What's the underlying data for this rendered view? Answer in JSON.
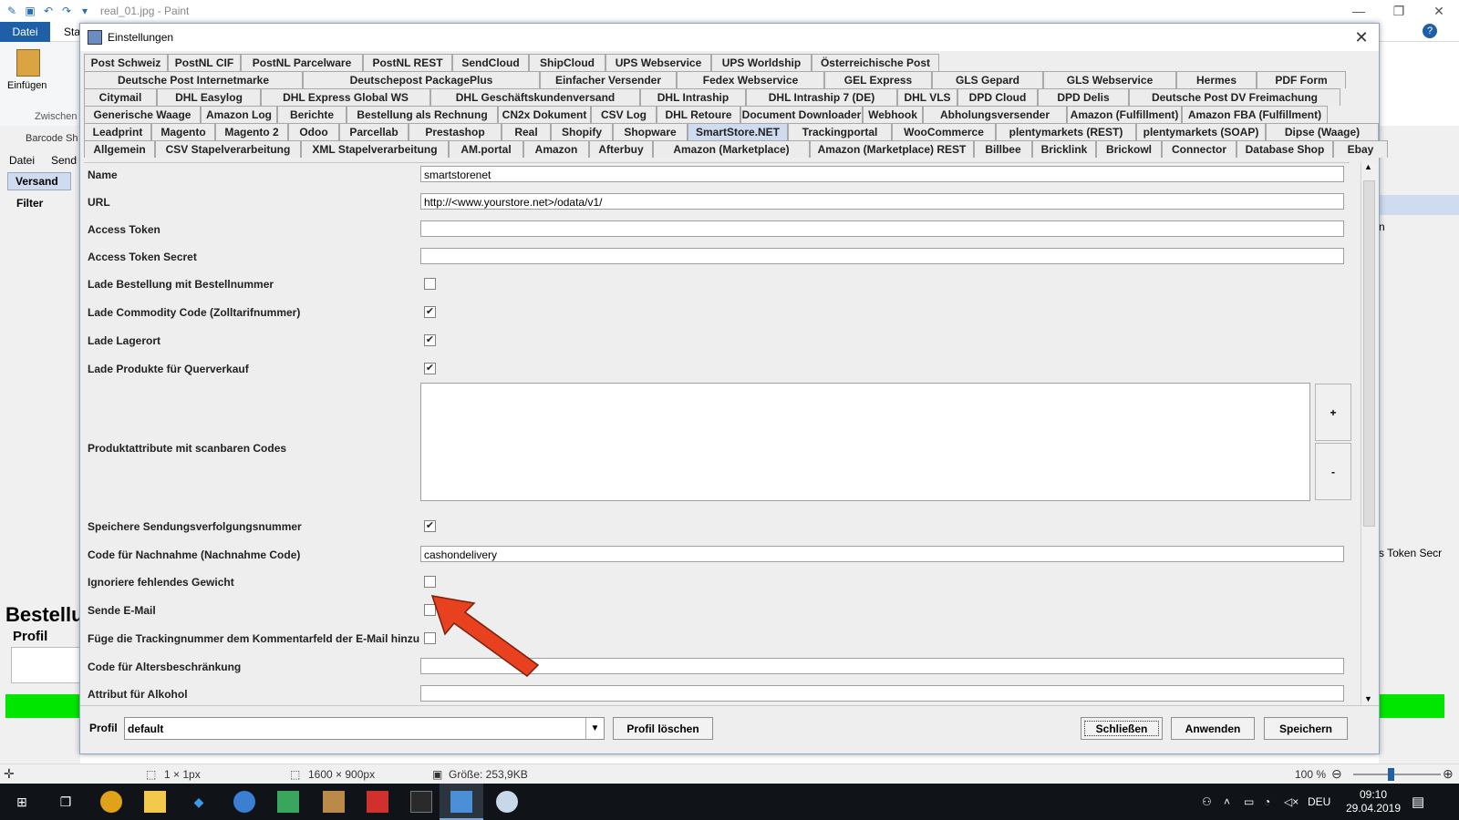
{
  "paint": {
    "title": "real_01.jpg - Paint",
    "ribbon_tab_file": "Datei",
    "ribbon_tab_start": "Sta",
    "paste": "Einfügen",
    "clipboard_group": "Zwischen"
  },
  "bg_app": {
    "title": "Barcode Sh",
    "menu": [
      "Datei",
      "Send"
    ],
    "tab": "Versand",
    "filter": "Filter",
    "heading": "Bestellu",
    "profile": "Profil",
    "right_fragment": "s Token Secr",
    "right_col": "n"
  },
  "dialog": {
    "title": "Einstellungen",
    "tabs": {
      "row1": [
        "Post Schweiz",
        "PostNL CIF",
        "PostNL Parcelware",
        "PostNL REST",
        "SendCloud",
        "ShipCloud",
        "UPS Webservice",
        "UPS Worldship",
        "Österreichische Post"
      ],
      "row2": [
        "Deutsche Post Internetmarke",
        "Deutschepost PackagePlus",
        "Einfacher Versender",
        "Fedex Webservice",
        "GEL Express",
        "GLS Gepard",
        "GLS Webservice",
        "Hermes",
        "PDF Form"
      ],
      "row3": [
        "Citymail",
        "DHL Easylog",
        "DHL Express Global WS",
        "DHL Geschäftskundenversand",
        "DHL Intraship",
        "DHL Intraship 7 (DE)",
        "DHL VLS",
        "DPD Cloud",
        "DPD Delis",
        "Deutsche Post DV Freimachung"
      ],
      "row4": [
        "Generische Waage",
        "Amazon Log",
        "Berichte",
        "Bestellung als Rechnung",
        "CN2x Dokument",
        "CSV Log",
        "DHL Retoure",
        "Document Downloader",
        "Webhook",
        "Abholungsversender",
        "Amazon (Fulfillment)",
        "Amazon FBA (Fulfillment)"
      ],
      "row5": [
        "Leadprint",
        "Magento",
        "Magento 2",
        "Odoo",
        "Parcellab",
        "Prestashop",
        "Real",
        "Shopify",
        "Shopware",
        "SmartStore.NET",
        "Trackingportal",
        "WooCommerce",
        "plentymarkets (REST)",
        "plentymarkets (SOAP)",
        "Dipse (Waage)"
      ],
      "row6": [
        "Allgemein",
        "CSV Stapelverarbeitung",
        "XML Stapelverarbeitung",
        "AM.portal",
        "Amazon",
        "Afterbuy",
        "Amazon (Marketplace)",
        "Amazon (Marketplace) REST",
        "Billbee",
        "Bricklink",
        "Brickowl",
        "Connector",
        "Database Shop",
        "Ebay"
      ],
      "selected": "SmartStore.NET"
    },
    "fields": {
      "name_label": "Name",
      "name_value": "smartstorenet",
      "url_label": "URL",
      "url_value": "http://<www.yourstore.net>/odata/v1/",
      "token_label": "Access Token",
      "token_value": "",
      "secret_label": "Access Token Secret",
      "secret_value": "",
      "load_order_label": "Lade Bestellung mit Bestellnummer",
      "load_order_checked": false,
      "commodity_label": "Lade Commodity Code (Zolltarifnummer)",
      "commodity_checked": true,
      "storage_label": "Lade Lagerort",
      "storage_checked": true,
      "cross_label": "Lade Produkte für Querverkauf",
      "cross_checked": true,
      "attr_label": "Produktattribute mit scanbaren Codes",
      "plus": "+",
      "minus": "-",
      "save_tracking_label": "Speichere Sendungsverfolgungsnummer",
      "save_tracking_checked": true,
      "cod_label": "Code für Nachnahme (Nachnahme Code)",
      "cod_value": "cashondelivery",
      "ignore_weight_label": "Ignoriere fehlendes Gewicht",
      "ignore_weight_checked": false,
      "send_mail_label": "Sende E-Mail",
      "send_mail_checked": false,
      "tracking_comment_label": "Füge die Trackingnummer dem Kommentarfeld der E-Mail hinzu",
      "tracking_comment_checked": false,
      "age_label": "Code für Altersbeschränkung",
      "age_value": "",
      "alcohol_label": "Attribut für Alkohol",
      "alcohol_value": ""
    },
    "bottom": {
      "profile_label": "Profil",
      "profile_value": "default",
      "delete_profile": "Profil löschen",
      "close": "Schließen",
      "apply": "Anwenden",
      "save": "Speichern"
    }
  },
  "statusbar": {
    "selection": "1 × 1px",
    "dimensions": "1600 × 900px",
    "size": "Größe: 253,9KB",
    "zoom": "100 %"
  },
  "taskbar": {
    "lang": "DEU",
    "time": "09:10",
    "date": "29.04.2019"
  },
  "colors": {
    "accent": "#1e5fa8",
    "arrow": "#e8411f",
    "green_bar": "#00e600",
    "taskbar": "#101418"
  }
}
